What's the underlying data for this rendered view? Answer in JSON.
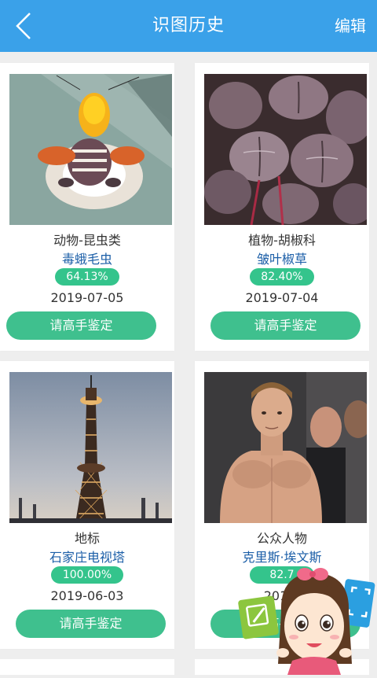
{
  "header": {
    "title": "识图历史",
    "edit_label": "编辑",
    "background": "#3aa1e9"
  },
  "cards": [
    {
      "category": "动物-昆虫类",
      "name": "毒蛾毛虫",
      "confidence": "64.13%",
      "date": "2019-07-05",
      "button": "请高手鉴定"
    },
    {
      "category": "植物-胡椒科",
      "name": "皱叶椒草",
      "confidence": "82.40%",
      "date": "2019-07-04",
      "button": "请高手鉴定"
    },
    {
      "category": "地标",
      "name": "石家庄电视塔",
      "confidence": "100.00%",
      "date": "2019-06-03",
      "button": "请高手鉴定"
    },
    {
      "category": "公众人物",
      "name": "克里斯·埃文斯",
      "confidence": "82.7",
      "date": "2019-",
      "button": "请高手鉴定"
    }
  ],
  "colors": {
    "accent_green": "#3fc08e",
    "badge_green": "#34c48c",
    "name_blue": "#1c5fa8"
  }
}
